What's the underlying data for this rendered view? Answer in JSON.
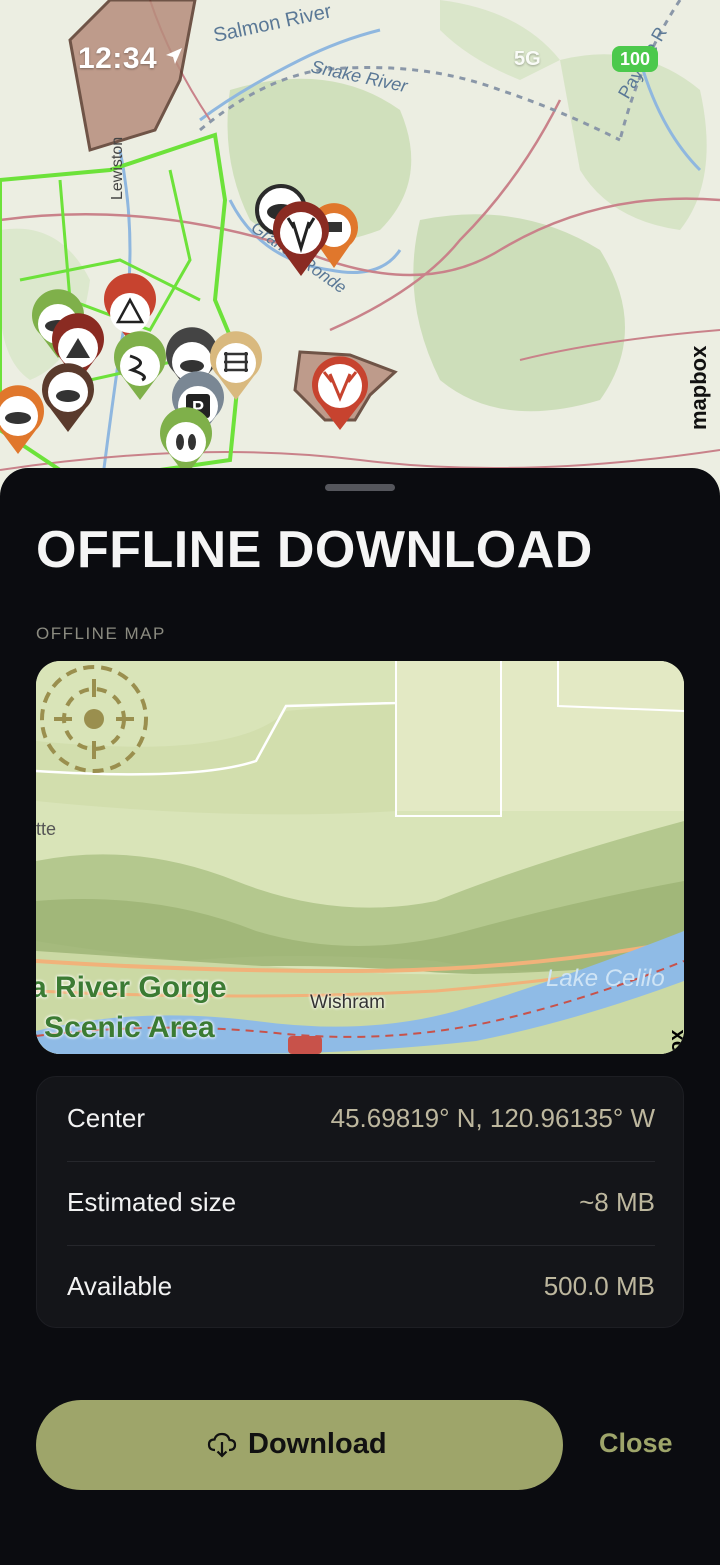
{
  "status_bar": {
    "time": "12:34",
    "signal": "5G",
    "battery": "100"
  },
  "background_map": {
    "labels": [
      "Salmon River",
      "Snake River",
      "Grande Ronde River",
      "Lewiston",
      "Payette R"
    ],
    "attribution": "mapbox"
  },
  "sheet": {
    "title": "OFFLINE DOWNLOAD",
    "section_label": "OFFLINE MAP",
    "preview": {
      "labels": {
        "gorge": "a River Gorge",
        "scenic": "Scenic Area",
        "town": "Wishram",
        "lake": "Lake Celilo",
        "edge": "tte"
      },
      "attribution": "ox"
    },
    "info": [
      {
        "key": "Center",
        "value": "45.69819° N, 120.96135° W"
      },
      {
        "key": "Estimated size",
        "value": "~8 MB"
      },
      {
        "key": "Available",
        "value": "500.0 MB"
      }
    ],
    "actions": {
      "download_label": "Download",
      "close_label": "Close"
    }
  },
  "colors": {
    "accent": "#9ea56a",
    "sheet_bg": "#0b0c10",
    "card_bg": "#141519",
    "value_text": "#bdb79e"
  }
}
